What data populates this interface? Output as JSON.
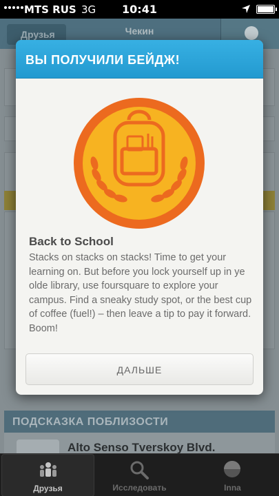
{
  "status_bar": {
    "carrier": "MTS RUS",
    "network": "3G",
    "time": "10:41"
  },
  "nav": {
    "back_label": "Друзья",
    "title": "Чекин"
  },
  "background": {
    "tip_header": "ПОДСКАЗКА ПОБЛИЗОСТИ",
    "tip_venue": "Alto Senso Tverskoy Blvd."
  },
  "modal": {
    "title": "ВЫ ПОЛУЧИЛИ БЕЙДЖ!",
    "badge_name": "Back to School",
    "badge_description": "Stacks on stacks on stacks! Time to get your learning on. But before you lock yourself up in ye olde library, use foursquare to explore your campus. Find a sneaky study spot, or the best cup of coffee (fuel!) – then leave a tip to pay it forward. Boom!",
    "next_label": "ДАЛЬШЕ"
  },
  "colors": {
    "accent": "#2da4d8",
    "badge_orange": "#ec6a1f",
    "badge_yellow": "#f7b321"
  },
  "tabs": [
    {
      "label": "Друзья",
      "icon": "friends-icon",
      "active": true
    },
    {
      "label": "Исследовать",
      "icon": "search-icon",
      "active": false
    },
    {
      "label": "Inna",
      "icon": "profile-icon",
      "active": false
    }
  ]
}
